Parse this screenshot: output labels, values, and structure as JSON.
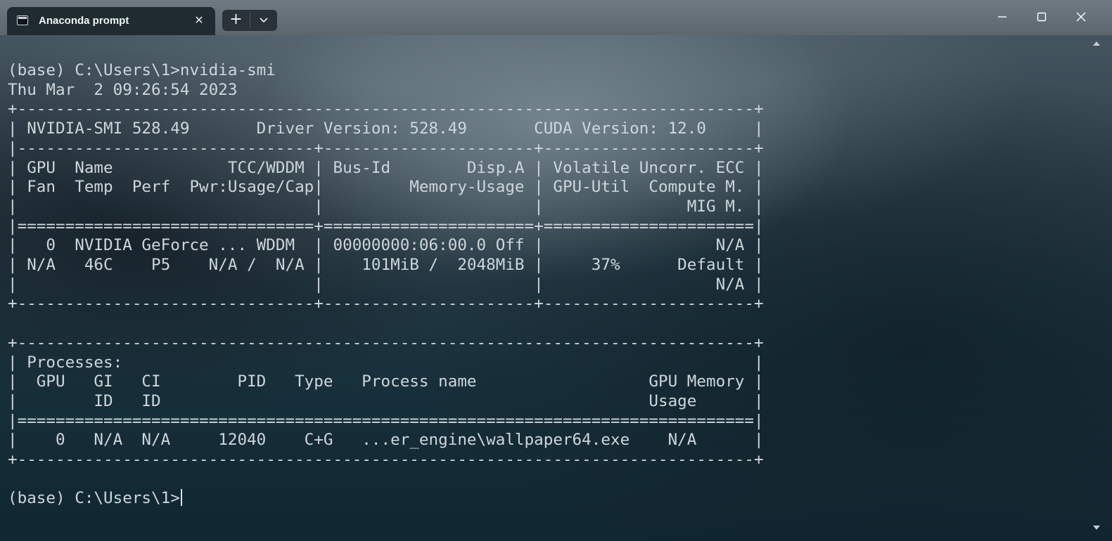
{
  "tab": {
    "title": "Anaconda prompt",
    "icon": "terminal-icon",
    "close_glyph": "✕"
  },
  "toolbar": {
    "new_tab_glyph": "+",
    "dropdown_icon": "chevron-down-icon"
  },
  "window_controls": [
    "minimize-icon",
    "maximize-icon",
    "close-icon"
  ],
  "terminal": {
    "lines": [
      "(base) C:\\Users\\1>nvidia-smi",
      "Thu Mar  2 09:26:54 2023",
      "+-----------------------------------------------------------------------------+",
      "| NVIDIA-SMI 528.49       Driver Version: 528.49       CUDA Version: 12.0     |",
      "|-------------------------------+----------------------+----------------------+",
      "| GPU  Name            TCC/WDDM | Bus-Id        Disp.A | Volatile Uncorr. ECC |",
      "| Fan  Temp  Perf  Pwr:Usage/Cap|         Memory-Usage | GPU-Util  Compute M. |",
      "|                               |                      |               MIG M. |",
      "|===============================+======================+======================|",
      "|   0  NVIDIA GeForce ... WDDM  | 00000000:06:00.0 Off |                  N/A |",
      "| N/A   46C    P5    N/A /  N/A |    101MiB /  2048MiB |     37%      Default |",
      "|                               |                      |                  N/A |",
      "+-------------------------------+----------------------+----------------------+",
      "",
      "+-----------------------------------------------------------------------------+",
      "| Processes:                                                                  |",
      "|  GPU   GI   CI        PID   Type   Process name                  GPU Memory |",
      "|        ID   ID                                                   Usage      |",
      "|=============================================================================|",
      "|    0   N/A  N/A     12040    C+G   ...er_engine\\wallpaper64.exe    N/A      |",
      "+-----------------------------------------------------------------------------+",
      "",
      "(base) C:\\Users\\1>"
    ]
  },
  "colors": {
    "titlebar": "#5b666e",
    "tab_background": "#1f2a31",
    "terminal_text": "#cfd6db"
  }
}
